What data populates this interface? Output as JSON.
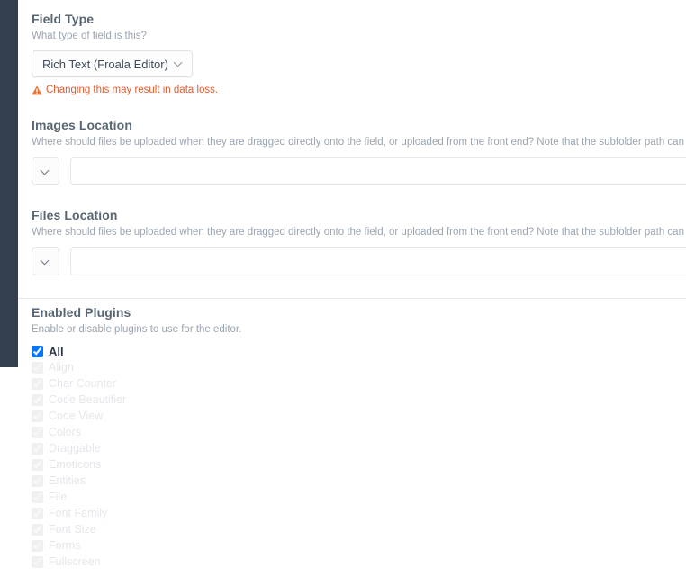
{
  "sidebar": {
    "color": "#343f4f"
  },
  "theme": {
    "heading_color": "#596673",
    "instruction_color": "#9aa5b1",
    "warning_color": "#e05d31"
  },
  "fields": {
    "field_type": {
      "heading": "Field Type",
      "instructions": "What type of field is this?",
      "selected_value": "Rich Text (Froala Editor)",
      "chevron_icon": "chevron-down-icon",
      "warning_icon": "warning-triangle-icon",
      "warning_text": "Changing this may result in data loss."
    },
    "images_location": {
      "heading": "Images Location",
      "instructions": "Where should files be uploaded when they are dragged directly onto the field, or uploaded from the front end? Note that the subfolder path can contain v",
      "select_chevron_icon": "chevron-down-icon",
      "select_value": "",
      "input_value": "",
      "input_placeholder": ""
    },
    "files_location": {
      "heading": "Files Location",
      "instructions": "Where should files be uploaded when they are dragged directly onto the field, or uploaded from the front end? Note that the subfolder path can contain v",
      "select_chevron_icon": "chevron-down-icon",
      "select_value": "",
      "input_value": "",
      "input_placeholder": ""
    },
    "enabled_plugins": {
      "heading": "Enabled Plugins",
      "instructions": "Enable or disable plugins to use for the editor.",
      "items": [
        {
          "label": "All",
          "checked": true,
          "disabled": false,
          "is_all": true
        },
        {
          "label": "Align",
          "checked": true,
          "disabled": true,
          "is_all": false
        },
        {
          "label": "Char Counter",
          "checked": true,
          "disabled": true,
          "is_all": false
        },
        {
          "label": "Code Beautifier",
          "checked": true,
          "disabled": true,
          "is_all": false
        },
        {
          "label": "Code View",
          "checked": true,
          "disabled": true,
          "is_all": false
        },
        {
          "label": "Colors",
          "checked": true,
          "disabled": true,
          "is_all": false
        },
        {
          "label": "Draggable",
          "checked": true,
          "disabled": true,
          "is_all": false
        },
        {
          "label": "Emoticons",
          "checked": true,
          "disabled": true,
          "is_all": false
        },
        {
          "label": "Entities",
          "checked": true,
          "disabled": true,
          "is_all": false
        },
        {
          "label": "File",
          "checked": true,
          "disabled": true,
          "is_all": false
        },
        {
          "label": "Font Family",
          "checked": true,
          "disabled": true,
          "is_all": false
        },
        {
          "label": "Font Size",
          "checked": true,
          "disabled": true,
          "is_all": false
        },
        {
          "label": "Forms",
          "checked": true,
          "disabled": true,
          "is_all": false
        },
        {
          "label": "Fullscreen",
          "checked": true,
          "disabled": true,
          "is_all": false
        }
      ]
    }
  }
}
